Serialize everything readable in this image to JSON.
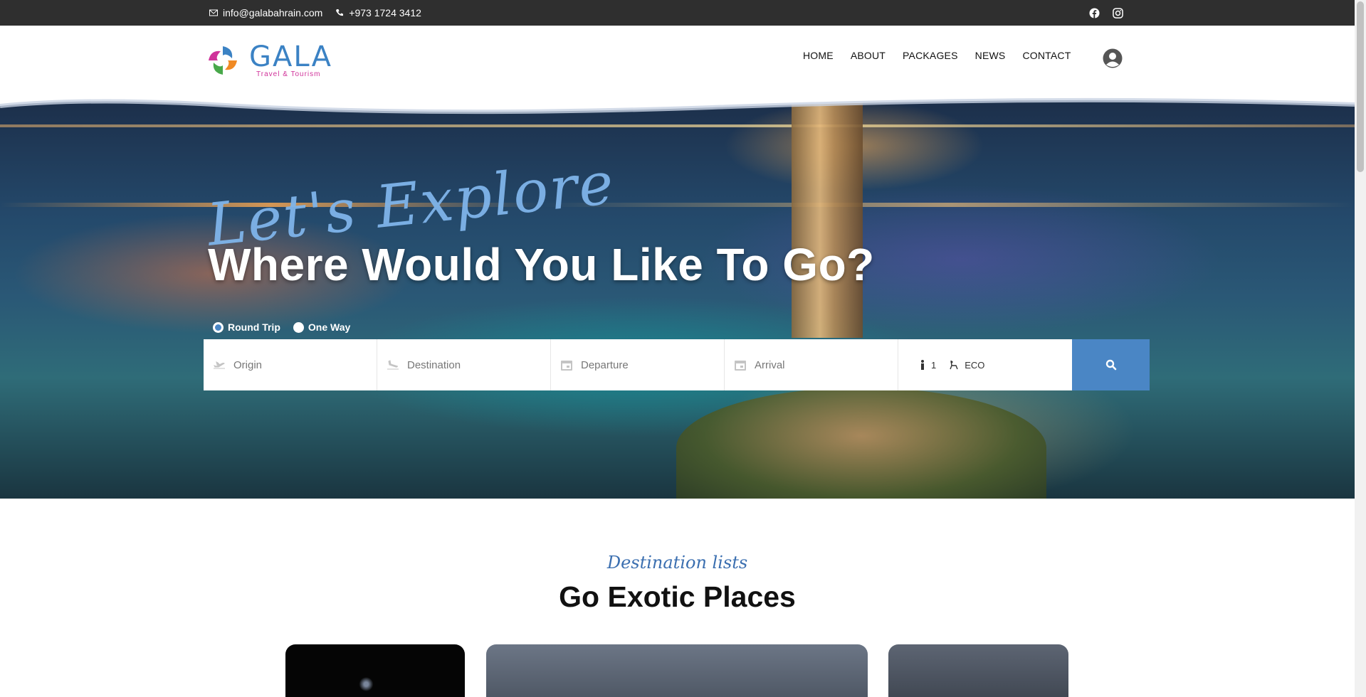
{
  "topbar": {
    "email": "info@galabahrain.com",
    "phone": "+973 1724 3412",
    "social": [
      "facebook-icon",
      "instagram-icon"
    ]
  },
  "header": {
    "brand": "GALA",
    "tagline": "Travel & Tourism",
    "nav": [
      "HOME",
      "ABOUT",
      "PACKAGES",
      "NEWS",
      "CONTACT"
    ]
  },
  "hero": {
    "script_text": "Let's Explore",
    "headline": "Where Would You Like To Go?",
    "trip_options": [
      {
        "label": "Round Trip",
        "selected": true
      },
      {
        "label": "One Way",
        "selected": false
      }
    ],
    "search": {
      "origin_placeholder": "Origin",
      "destination_placeholder": "Destination",
      "departure_placeholder": "Departure",
      "arrival_placeholder": "Arrival",
      "passengers": "1",
      "cabin_class": "ECO"
    }
  },
  "destinations": {
    "script_text": "Destination lists",
    "title": "Go Exotic Places"
  },
  "colors": {
    "accent": "#4a86c5",
    "topbar": "#2f2f2f",
    "brand_blue": "#3b82c4",
    "brand_pink": "#d0329a"
  }
}
